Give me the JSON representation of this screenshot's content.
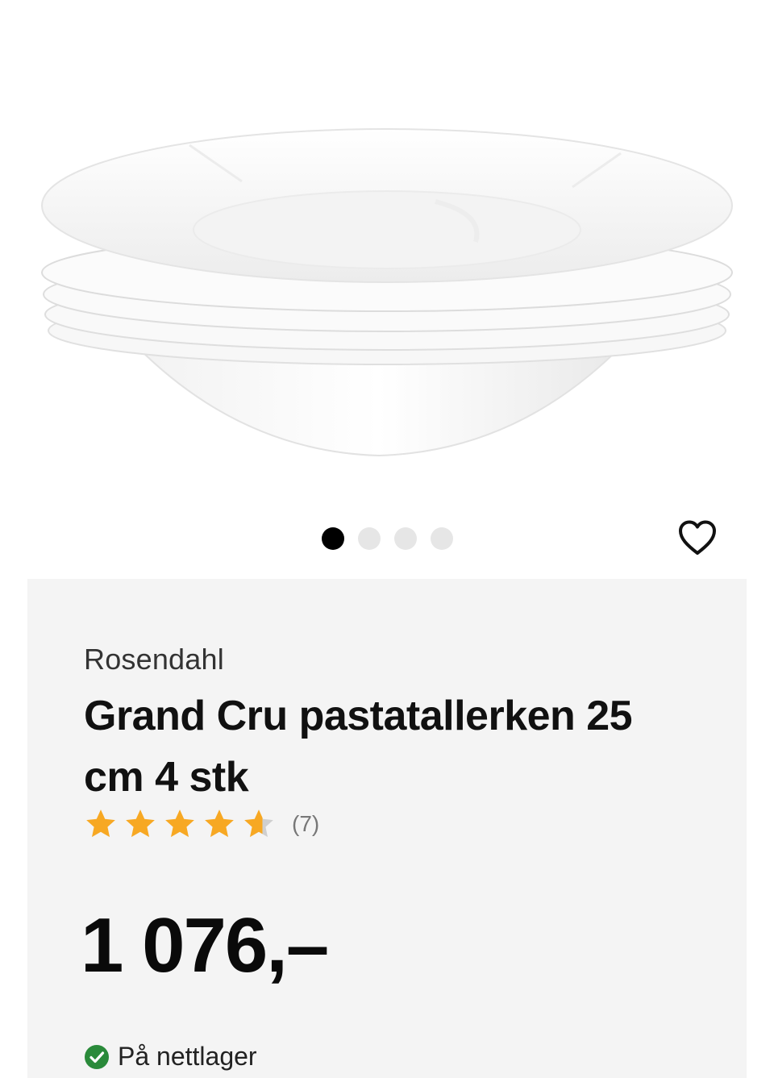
{
  "gallery": {
    "image_alt": "Grand Cru pastatallerken stack",
    "slide_count": 4,
    "active_slide": 1
  },
  "favorite": {
    "icon": "heart-outline-icon"
  },
  "product": {
    "brand": "Rosendahl",
    "title": "Grand Cru pastatallerken 25 cm 4 stk",
    "rating": {
      "value": 4.5,
      "max": 5,
      "count_label": "(7)"
    },
    "price": "1 076,–",
    "stock": {
      "icon": "check-circle-icon",
      "label": "På nettlager"
    }
  },
  "colors": {
    "star": "#f7a823",
    "star_empty": "#cfcfcf",
    "stock_ok": "#2a8a3a",
    "panel_bg": "#f4f4f4"
  }
}
